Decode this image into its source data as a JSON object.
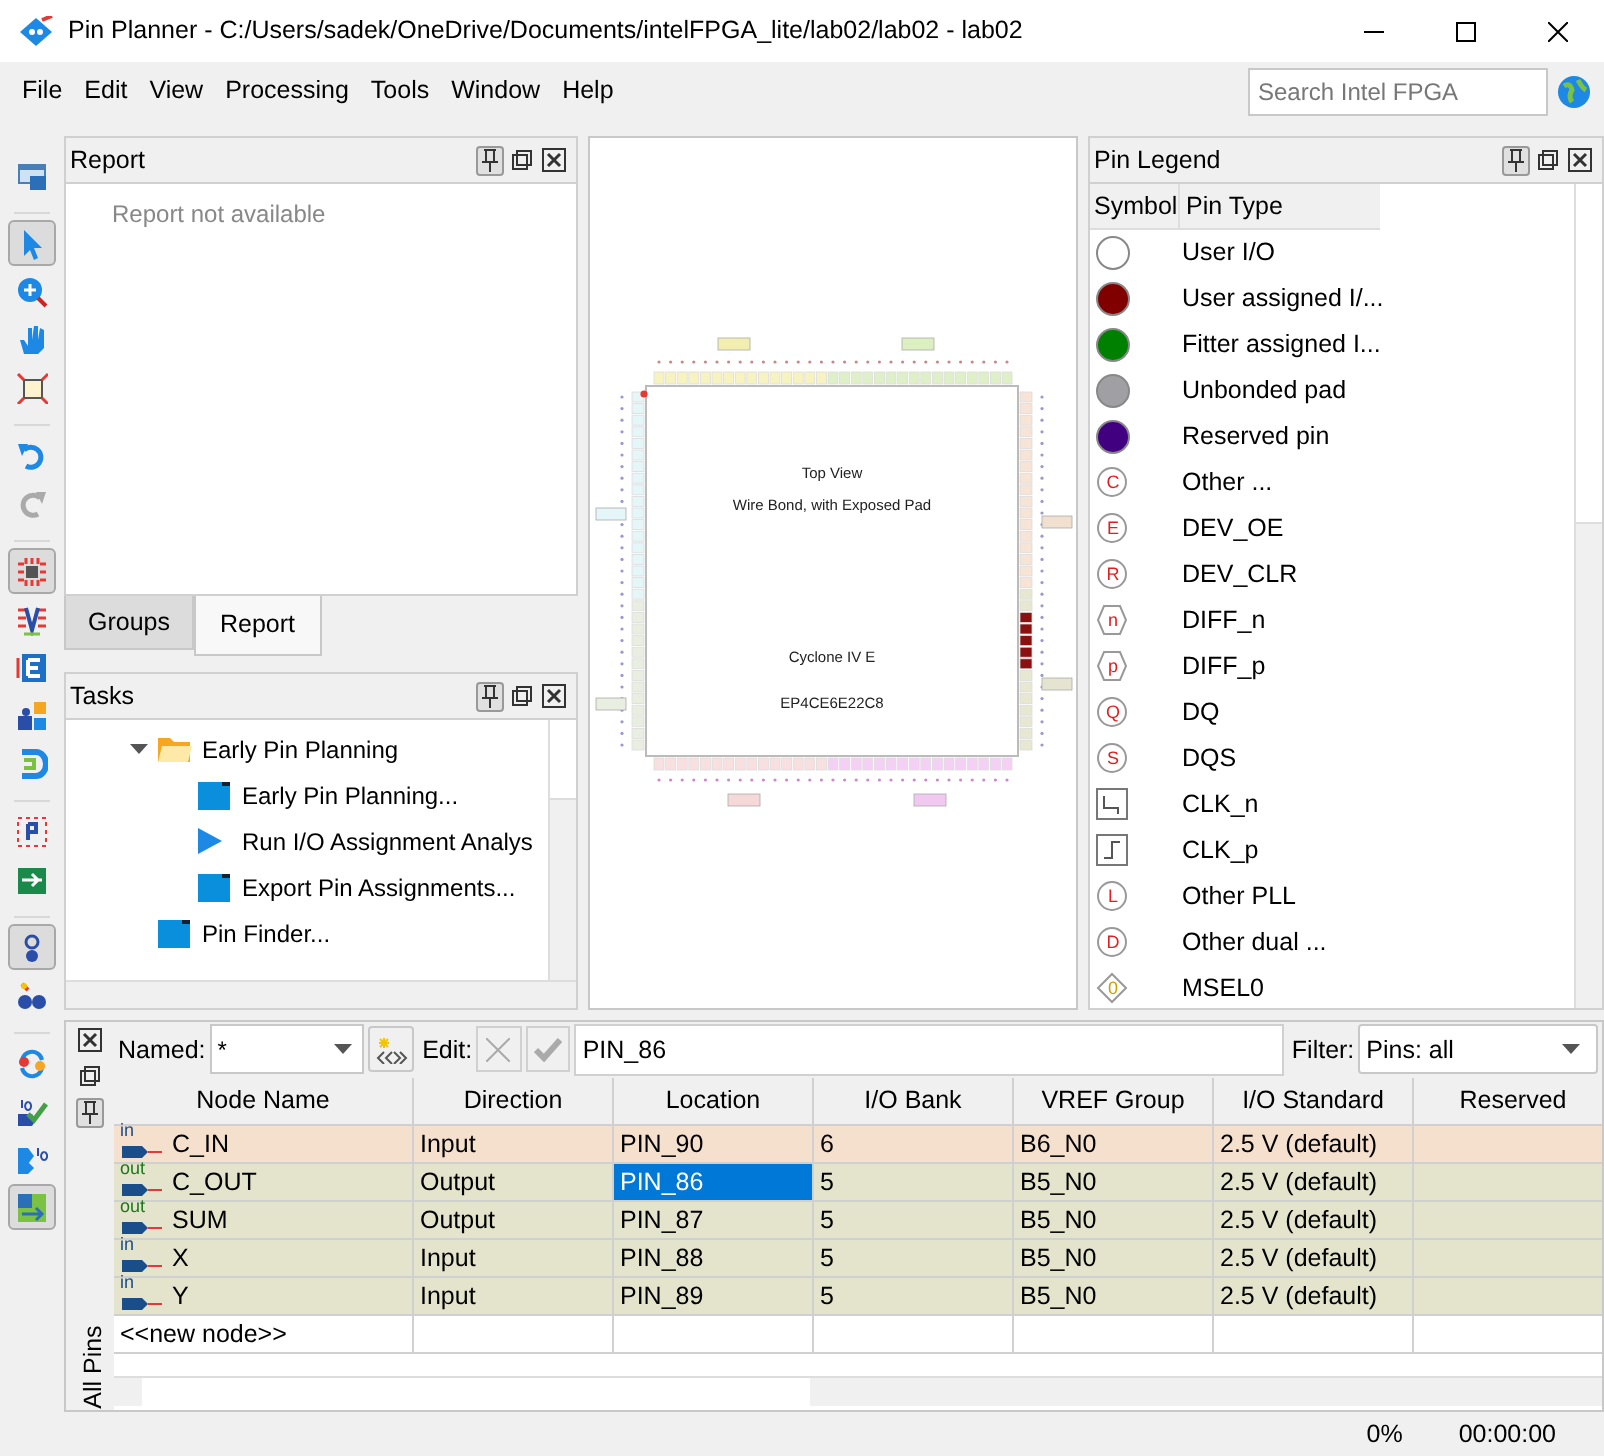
{
  "window": {
    "title": "Pin Planner - C:/Users/sadek/OneDrive/Documents/intelFPGA_lite/lab02/lab02 - lab02"
  },
  "menu": [
    "File",
    "Edit",
    "View",
    "Processing",
    "Tools",
    "Window",
    "Help"
  ],
  "search": {
    "placeholder": "Search Intel FPGA"
  },
  "toolbar": [
    {
      "kind": "window",
      "selected": false
    },
    {
      "kind": "pointer",
      "selected": true
    },
    {
      "kind": "zoom",
      "selected": false
    },
    {
      "kind": "hand",
      "selected": false
    },
    {
      "kind": "fit",
      "selected": false
    },
    {
      "kind": "undo",
      "selected": false
    },
    {
      "kind": "redo",
      "selected": false
    },
    {
      "kind": "chip",
      "selected": true
    },
    {
      "kind": "vgrid",
      "selected": false
    },
    {
      "kind": "ebox",
      "selected": false
    },
    {
      "kind": "puzzle",
      "selected": false
    },
    {
      "kind": "bracket",
      "selected": false
    },
    {
      "kind": "pgrid",
      "selected": false
    },
    {
      "kind": "iogreen",
      "selected": false
    },
    {
      "kind": "toggle",
      "selected": true
    },
    {
      "kind": "binoculars",
      "selected": false
    },
    {
      "kind": "refresh",
      "selected": false
    },
    {
      "kind": "iocheck",
      "selected": false
    },
    {
      "kind": "iopin",
      "selected": false
    },
    {
      "kind": "swap",
      "selected": true
    }
  ],
  "report": {
    "title": "Report",
    "message": "Report not available"
  },
  "tabs": [
    {
      "label": "Groups",
      "selected": false
    },
    {
      "label": "Report",
      "selected": true
    }
  ],
  "tasks": {
    "title": "Tasks",
    "items": [
      {
        "label": "Early Pin Planning",
        "kind": "folder",
        "expanded": true,
        "children": [
          {
            "label": "Early Pin Planning...",
            "kind": "task"
          },
          {
            "label": "Run I/O Assignment Analys",
            "kind": "run"
          },
          {
            "label": "Export Pin Assignments...",
            "kind": "task"
          }
        ]
      },
      {
        "label": "Pin Finder...",
        "kind": "task"
      }
    ]
  },
  "chip": {
    "view": "Top View",
    "package": "Wire Bond, with Exposed Pad",
    "family": "Cyclone IV E",
    "device": "EP4CE6E22C8"
  },
  "legend": {
    "title": "Pin Legend",
    "columns": [
      "Symbol",
      "Pin Type"
    ],
    "items": [
      {
        "kind": "dot",
        "color": "#ffffff",
        "label": "User I/O"
      },
      {
        "kind": "dot",
        "color": "#800000",
        "label": "User assigned I/..."
      },
      {
        "kind": "dot",
        "color": "#008000",
        "label": "Fitter assigned I..."
      },
      {
        "kind": "dot",
        "color": "#a0a0a4",
        "label": "Unbonded pad"
      },
      {
        "kind": "dot",
        "color": "#400080",
        "label": "Reserved pin"
      },
      {
        "kind": "letter",
        "symbol": "C",
        "label": "Other ..."
      },
      {
        "kind": "letter",
        "symbol": "E",
        "label": "DEV_OE"
      },
      {
        "kind": "letter",
        "symbol": "R",
        "label": "DEV_CLR"
      },
      {
        "kind": "hexagon",
        "symbol": "n",
        "label": "DIFF_n"
      },
      {
        "kind": "hexagon",
        "symbol": "p",
        "label": "DIFF_p"
      },
      {
        "kind": "letter",
        "symbol": "Q",
        "label": "DQ"
      },
      {
        "kind": "letter",
        "symbol": "S",
        "label": "DQS"
      },
      {
        "kind": "clk_n",
        "label": "CLK_n"
      },
      {
        "kind": "clk_p",
        "label": "CLK_p"
      },
      {
        "kind": "letter",
        "symbol": "L",
        "label": "Other PLL"
      },
      {
        "kind": "letter",
        "symbol": "D",
        "label": "Other dual ..."
      },
      {
        "kind": "diamond",
        "symbol": "0",
        "label": "MSEL0"
      }
    ]
  },
  "pins": {
    "side_tab": "All Pins",
    "named_label": "Named:",
    "named_value": "*",
    "edit_label": "Edit:",
    "edit_value": "PIN_86",
    "filter_label": "Filter:",
    "filter_value": "Pins: all",
    "columns": [
      "Node Name",
      "Direction",
      "Location",
      "I/O Bank",
      "VREF Group",
      "I/O Standard",
      "Reserved"
    ],
    "rows": [
      {
        "io": "in",
        "name": "C_IN",
        "direction": "Input",
        "location": "PIN_90",
        "bank": "6",
        "vref": "B6_N0",
        "standard": "2.5 V (default)",
        "color": "#f5dfcd",
        "selected": false
      },
      {
        "io": "out",
        "name": "C_OUT",
        "direction": "Output",
        "location": "PIN_86",
        "bank": "5",
        "vref": "B5_N0",
        "standard": "2.5 V (default)",
        "color": "#e4e3cb",
        "selected": true
      },
      {
        "io": "out",
        "name": "SUM",
        "direction": "Output",
        "location": "PIN_87",
        "bank": "5",
        "vref": "B5_N0",
        "standard": "2.5 V (default)",
        "color": "#e4e3cb",
        "selected": false
      },
      {
        "io": "in",
        "name": "X",
        "direction": "Input",
        "location": "PIN_88",
        "bank": "5",
        "vref": "B5_N0",
        "standard": "2.5 V (default)",
        "color": "#e4e3cb",
        "selected": false
      },
      {
        "io": "in",
        "name": "Y",
        "direction": "Input",
        "location": "PIN_89",
        "bank": "5",
        "vref": "B5_N0",
        "standard": "2.5 V (default)",
        "color": "#e4e3cb",
        "selected": false
      }
    ],
    "new_node": "<<new node>>"
  },
  "status": {
    "progress": "0%",
    "time": "00:00:00"
  }
}
